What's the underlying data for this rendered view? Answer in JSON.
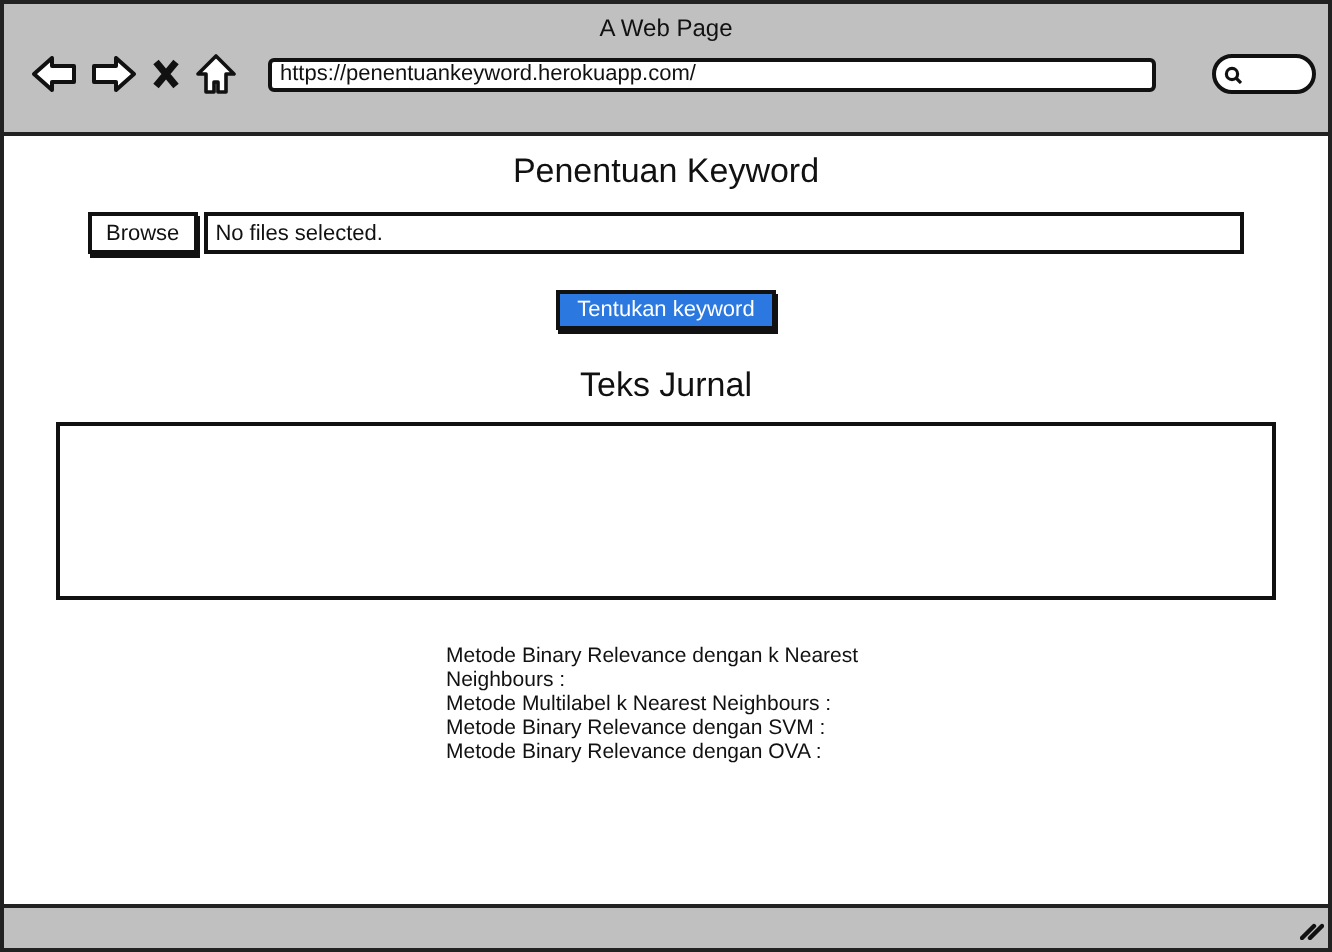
{
  "window": {
    "title": "A Web Page",
    "url": "https://penentuankeyword.herokuapp.com/"
  },
  "page": {
    "heading": "Penentuan Keyword",
    "file_input": {
      "button": "Browse",
      "value": "No files selected."
    },
    "submit_button": "Tentukan keyword",
    "section_heading": "Teks Jurnal",
    "results": [
      "Metode Binary Relevance dengan k Nearest Neighbours :",
      "Metode Multilabel k Nearest Neighbours :",
      "Metode Binary Relevance dengan SVM :",
      "Metode Binary Relevance dengan OVA :"
    ]
  }
}
